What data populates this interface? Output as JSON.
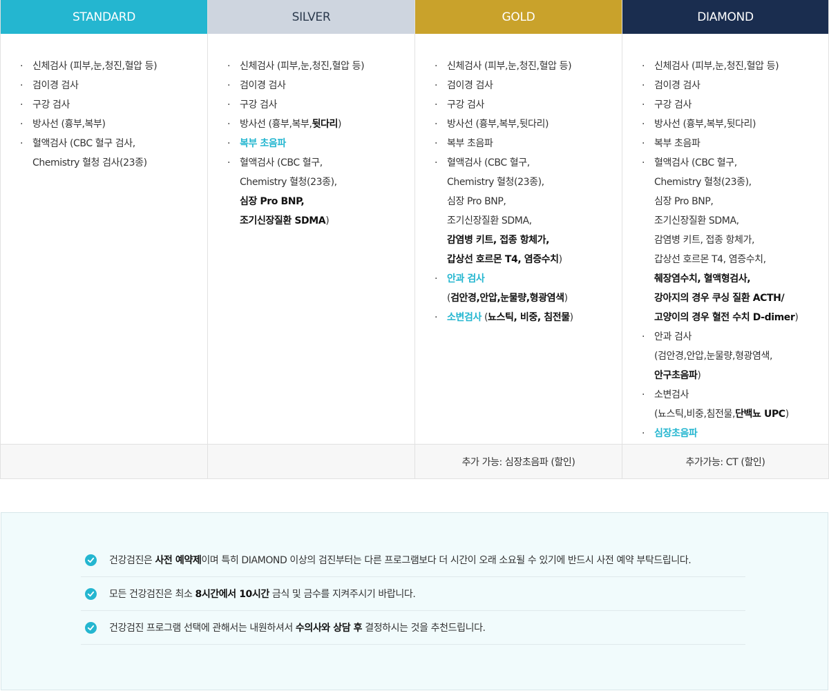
{
  "plans": [
    {
      "name": "STANDARD",
      "items": [
        [
          [
            {
              "t": "신체검사 (피부,눈,청진,혈압 등)"
            }
          ]
        ],
        [
          [
            {
              "t": "검이경 검사"
            }
          ]
        ],
        [
          [
            {
              "t": "구강 검사"
            }
          ]
        ],
        [
          [
            {
              "t": "방사선 (흉부,복부)"
            }
          ]
        ],
        [
          [
            {
              "t": "혈액검사 (CBC 혈구 검사,"
            }
          ],
          [
            {
              "t": "Chemistry 혈청 검사(23종)"
            }
          ]
        ]
      ],
      "footer": ""
    },
    {
      "name": "SILVER",
      "items": [
        [
          [
            {
              "t": "신체검사 (피부,눈,청진,혈압 등)"
            }
          ]
        ],
        [
          [
            {
              "t": "검이경 검사"
            }
          ]
        ],
        [
          [
            {
              "t": "구강 검사"
            }
          ]
        ],
        [
          [
            {
              "t": "방사선 (흉부,복부,"
            },
            {
              "t": "뒷다리",
              "s": "b"
            },
            {
              "t": ")"
            }
          ]
        ],
        [
          [
            {
              "t": "복부 초음파",
              "s": "hl"
            }
          ]
        ],
        [
          [
            {
              "t": "혈액검사 (CBC 혈구,"
            }
          ],
          [
            {
              "t": "Chemistry 혈청(23종),"
            }
          ],
          [
            {
              "t": "심장  Pro BNP,",
              "s": "b"
            }
          ],
          [
            {
              "t": "조기신장질환 SDMA",
              "s": "b"
            },
            {
              "t": ")"
            }
          ]
        ]
      ],
      "footer": ""
    },
    {
      "name": "GOLD",
      "items": [
        [
          [
            {
              "t": "신체검사 (피부,눈,청진,혈압 등)"
            }
          ]
        ],
        [
          [
            {
              "t": "검이경 검사"
            }
          ]
        ],
        [
          [
            {
              "t": "구강 검사"
            }
          ]
        ],
        [
          [
            {
              "t": "방사선 (흉부,복부,뒷다리)"
            }
          ]
        ],
        [
          [
            {
              "t": "복부 초음파"
            }
          ]
        ],
        [
          [
            {
              "t": "혈액검사 (CBC 혈구,"
            }
          ],
          [
            {
              "t": "Chemistry 혈청(23종),"
            }
          ],
          [
            {
              "t": "심장 Pro BNP,"
            }
          ],
          [
            {
              "t": "조기신장질환 SDMA,"
            }
          ],
          [
            {
              "t": "감염병 키트, 접종 항체가,",
              "s": "b"
            }
          ],
          [
            {
              "t": "갑상선 호르몬 T4, 염증수치",
              "s": "b"
            },
            {
              "t": ")"
            }
          ]
        ],
        [
          [
            {
              "t": "안과 검사",
              "s": "hl"
            }
          ],
          [
            {
              "t": "("
            },
            {
              "t": "검안경,안압,눈물량,형광염색",
              "s": "b"
            },
            {
              "t": ")"
            }
          ]
        ],
        [
          [
            {
              "t": "소변검사",
              "s": "hl"
            },
            {
              "t": " ("
            },
            {
              "t": "뇨스틱, 비중, 침전물",
              "s": "b"
            },
            {
              "t": ")"
            }
          ]
        ]
      ],
      "footer": "추가 가능: 심장초음파 (할인)"
    },
    {
      "name": "DIAMOND",
      "items": [
        [
          [
            {
              "t": "신체검사 (피부,눈,청진,혈압 등)"
            }
          ]
        ],
        [
          [
            {
              "t": "검이경 검사"
            }
          ]
        ],
        [
          [
            {
              "t": "구강 검사"
            }
          ]
        ],
        [
          [
            {
              "t": "방사선 (흉부,복부,뒷다리)"
            }
          ]
        ],
        [
          [
            {
              "t": "복부 초음파"
            }
          ]
        ],
        [
          [
            {
              "t": "혈액검사 (CBC 혈구,"
            }
          ],
          [
            {
              "t": "Chemistry 혈청(23종),"
            }
          ],
          [
            {
              "t": "심장 Pro BNP,"
            }
          ],
          [
            {
              "t": "조기신장질환 SDMA,"
            }
          ],
          [
            {
              "t": "감염병 키트, 접종 항체가,"
            }
          ],
          [
            {
              "t": "갑상선 호르몬 T4, 염증수치,"
            }
          ],
          [
            {
              "t": "췌장염수치, 혈액형검사,",
              "s": "b"
            }
          ],
          [
            {
              "t": "강아지의 경우 쿠싱 질환 ACTH/",
              "s": "b"
            }
          ],
          [
            {
              "t": "고양이의 경우 혈전 수치 D-dimer",
              "s": "b"
            },
            {
              "t": ")"
            }
          ]
        ],
        [
          [
            {
              "t": "안과 검사"
            }
          ],
          [
            {
              "t": "(검안경,안압,눈물량,형광염색,"
            }
          ],
          [
            {
              "t": "안구초음파",
              "s": "b"
            },
            {
              "t": ")"
            }
          ]
        ],
        [
          [
            {
              "t": "소변검사"
            }
          ],
          [
            {
              "t": "(뇨스틱,비중,침전물,"
            },
            {
              "t": "단백뇨 UPC",
              "s": "b"
            },
            {
              "t": ")"
            }
          ]
        ],
        [
          [
            {
              "t": "심장초음파",
              "s": "hl"
            }
          ]
        ]
      ],
      "footer": "추가가능: CT (할인)"
    }
  ],
  "notices": [
    [
      {
        "t": "건강검진은 "
      },
      {
        "t": "사전 예약제",
        "s": "b"
      },
      {
        "t": "이며 특히 DIAMOND 이상의 검진부터는 다른 프로그램보다 더 시간이 오래 소요될 수 있기에 반드시 사전 예약 부탁드립니다."
      }
    ],
    [
      {
        "t": "모든 건강검진은 최소 "
      },
      {
        "t": "8시간에서 10시간",
        "s": "b"
      },
      {
        "t": " 금식 및 금수를 지켜주시기 바랍니다."
      }
    ],
    [
      {
        "t": "건강검진 프로그램 선택에 관해서는 내원하셔서 "
      },
      {
        "t": "수의사와 상담 후",
        "s": "b"
      },
      {
        "t": "  결정하시는 것을 추천드립니다."
      }
    ]
  ],
  "colors": {
    "standard": "#24b6d0",
    "silver": "#ced5df",
    "gold": "#c9a22b",
    "diamond": "#1a2d4f",
    "highlight": "#24b6d0"
  },
  "icons": {
    "bullet": "middle-dot",
    "notice": "check-circle-icon"
  }
}
